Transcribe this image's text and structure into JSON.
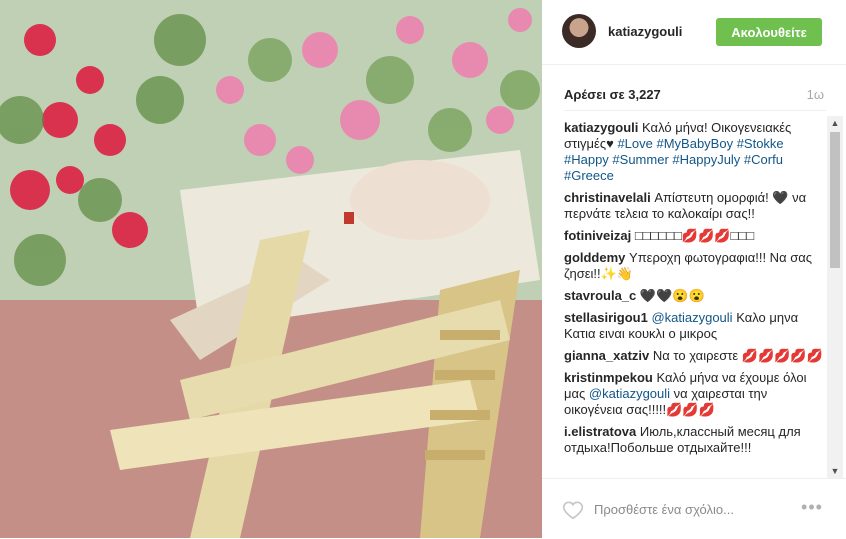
{
  "post": {
    "username": "katiazygouli",
    "follow_label": "Ακολουθείτε",
    "likes_label": "Αρέσει σε 3,227",
    "time": "1ω"
  },
  "comments": [
    {
      "user": "katiazygouli",
      "text": "Καλό μήνα! Οικογενειακές στιγμές♥",
      "tags": "#Love #MyBabyBoy #Stokke #Happy #Summer #HappyJuly #Corfu #Greece"
    },
    {
      "user": "christinavelali",
      "text": "Απίστευτη ομορφιά! 🖤 να περνάτε τελεια το καλοκαίρι σας!!"
    },
    {
      "user": "fotiniveizaj",
      "text": "□□□□□□💋💋💋□□□"
    },
    {
      "user": "golddemy",
      "text": "Υπεροχη φωτογραφια!!! Να σας ζησει!!✨👋"
    },
    {
      "user": "stavroula_c",
      "text": "🖤🖤😮😮"
    },
    {
      "user": "stellasirigou1",
      "mention": "@katiazygouli",
      "text": "Καλο μηνα Κατια ειναι κουκλι ο μικρος"
    },
    {
      "user": "gianna_xatziv",
      "text": "Να το χαιρεστε 💋💋💋💋💋"
    },
    {
      "user": "kristinmpekou",
      "text": "Καλό μήνα να έχουμε όλοι μας",
      "mention": "@katiazygouli",
      "text2": "να χαιρεσται την οικογένεια σας!!!!!💋💋💋"
    },
    {
      "user": "i.elistratova",
      "text": "Июль,классный месяц для отдыха!Побольше отдыхайте!!!"
    }
  ],
  "footer": {
    "comment_placeholder": "Προσθέστε ένα σχόλιο...",
    "more_label": "•••"
  },
  "icons": {
    "heart": "heart-icon",
    "more": "more-options-icon",
    "scroll_up": "scroll-up-icon",
    "scroll_down": "scroll-down-icon"
  },
  "colors": {
    "follow_bg": "#70c050",
    "link": "#125688"
  }
}
